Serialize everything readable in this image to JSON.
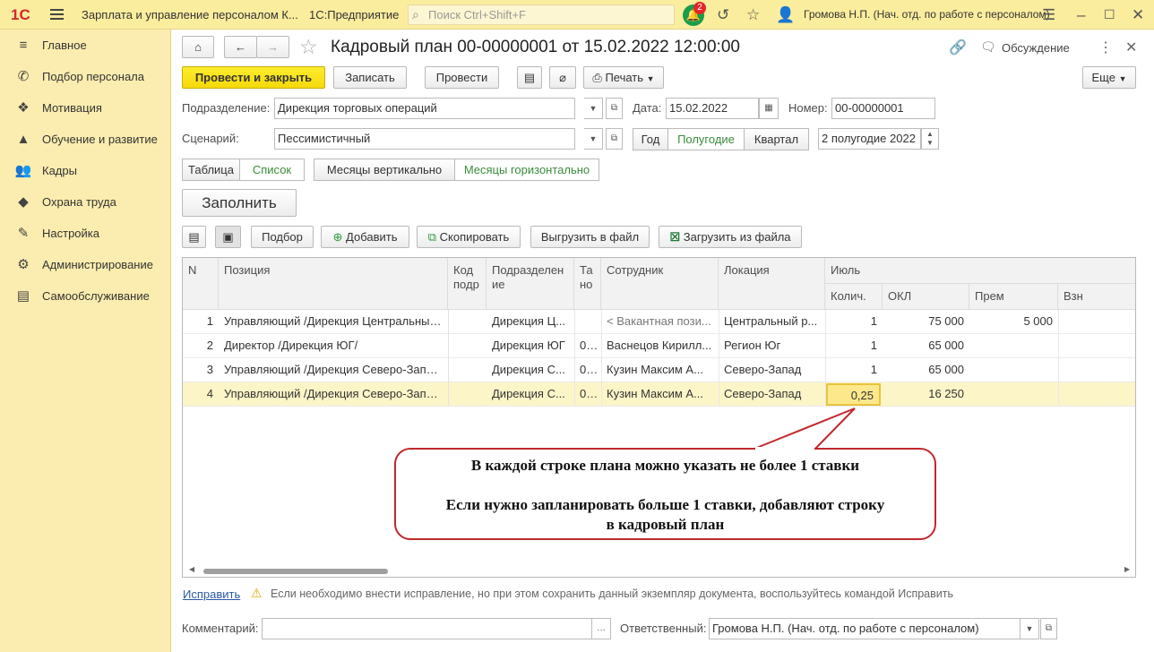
{
  "app": {
    "logo": "1С",
    "title": "Зарплата и управление персоналом К...",
    "platform": "1С:Предприятие",
    "search_placeholder": "Поиск Ctrl+Shift+F",
    "notifications": "2",
    "user": "Громова Н.П. (Нач. отд. по работе с персоналом)"
  },
  "sidebar": {
    "items": [
      {
        "label": "Главное",
        "icon": "menu-icon"
      },
      {
        "label": "Подбор персонала",
        "icon": "phone-icon"
      },
      {
        "label": "Мотивация",
        "icon": "gift-icon"
      },
      {
        "label": "Обучение и развитие",
        "icon": "graduation-cap-icon"
      },
      {
        "label": "Кадры",
        "icon": "people-icon"
      },
      {
        "label": "Охрана труда",
        "icon": "shield-icon"
      },
      {
        "label": "Настройка",
        "icon": "wrench-icon"
      },
      {
        "label": "Администрирование",
        "icon": "gear-icon"
      },
      {
        "label": "Самообслуживание",
        "icon": "id-card-icon"
      }
    ]
  },
  "doc": {
    "title": "Кадровый план 00-00000001 от 15.02.2022 12:00:00",
    "discussion": "Обсуждение"
  },
  "toolbar": {
    "post_close": "Провести и закрыть",
    "save": "Записать",
    "post": "Провести",
    "print": "Печать",
    "more": "Еще"
  },
  "form": {
    "dept_label": "Подразделение:",
    "dept_value": "Дирекция торговых операций",
    "date_label": "Дата:",
    "date_value": "15.02.2022",
    "number_label": "Номер:",
    "number_value": "00-00000001",
    "scenario_label": "Сценарий:",
    "scenario_value": "Пессимистичный",
    "period_year": "Год",
    "period_half": "Полугодие",
    "period_quarter": "Квартал",
    "period_value": "2 полугодие 2022",
    "view_table": "Таблица",
    "view_list": "Список",
    "months_vertical": "Месяцы вертикально",
    "months_horizontal": "Месяцы горизонтально",
    "fill": "Заполнить"
  },
  "table_toolbar": {
    "pick": "Подбор",
    "add": "Добавить",
    "copy": "Скопировать",
    "export": "Выгрузить в файл",
    "import": "Загрузить из файла"
  },
  "table": {
    "headers": {
      "n": "N",
      "position": "Позиция",
      "code_1": "Код",
      "code_2": "подр",
      "dept_1": "Подразделен",
      "dept_2": "ие",
      "ta_1": "Та",
      "ta_2": "но",
      "employee": "Сотрудник",
      "location": "Локация",
      "month": "Июль",
      "qty": "Колич.",
      "okl": "ОКЛ",
      "prem": "Прем",
      "vzn": "Взн"
    },
    "rows": [
      {
        "n": "1",
        "position": "Управляющий /Дирекция Центральный ...",
        "code": "",
        "dept": "Дирекция Ц...",
        "ta": "",
        "employee": "< Вакантная пози...",
        "location": "Центральный р...",
        "qty": "1",
        "okl": "75 000",
        "prem": "5 000",
        "vzn": ""
      },
      {
        "n": "2",
        "position": "Директор /Дирекция ЮГ/",
        "code": "",
        "dept": "Дирекция ЮГ",
        "ta": "0...",
        "employee": "Васнецов Кирилл...",
        "location": "Регион Юг",
        "qty": "1",
        "okl": "65 000",
        "prem": "",
        "vzn": ""
      },
      {
        "n": "3",
        "position": "Управляющий /Дирекция Северо-Запад/",
        "code": "",
        "dept": "Дирекция С...",
        "ta": "0...",
        "employee": "Кузин Максим А...",
        "location": "Северо-Запад",
        "qty": "1",
        "okl": "65 000",
        "prem": "",
        "vzn": ""
      },
      {
        "n": "4",
        "position": "Управляющий /Дирекция Северо-Запад/",
        "code": "",
        "dept": "Дирекция С...",
        "ta": "0...",
        "employee": "Кузин Максим А...",
        "location": "Северо-Запад",
        "qty": "0,25",
        "okl": "16 250",
        "prem": "",
        "vzn": ""
      }
    ]
  },
  "callout": {
    "line1": "В каждой строке плана можно указать не более 1 ставки",
    "line2": "Если нужно запланировать больше 1 ставки, добавляют строку",
    "line3": "в кадровый план"
  },
  "footer": {
    "fix_link": "Исправить",
    "fix_hint": "Если необходимо внести исправление, но при этом сохранить данный экземпляр документа, воспользуйтесь командой Исправить",
    "comment_label": "Комментарий:",
    "comment_value": "",
    "responsible_label": "Ответственный:",
    "responsible_value": "Громова Н.П. (Нач. отд. по работе с персоналом)"
  },
  "colors": {
    "accent_yellow": "#f5d90b",
    "sidebar_bg": "#fbedaf",
    "callout_border": "#c0282d",
    "selected_row": "#fcf5c8"
  }
}
